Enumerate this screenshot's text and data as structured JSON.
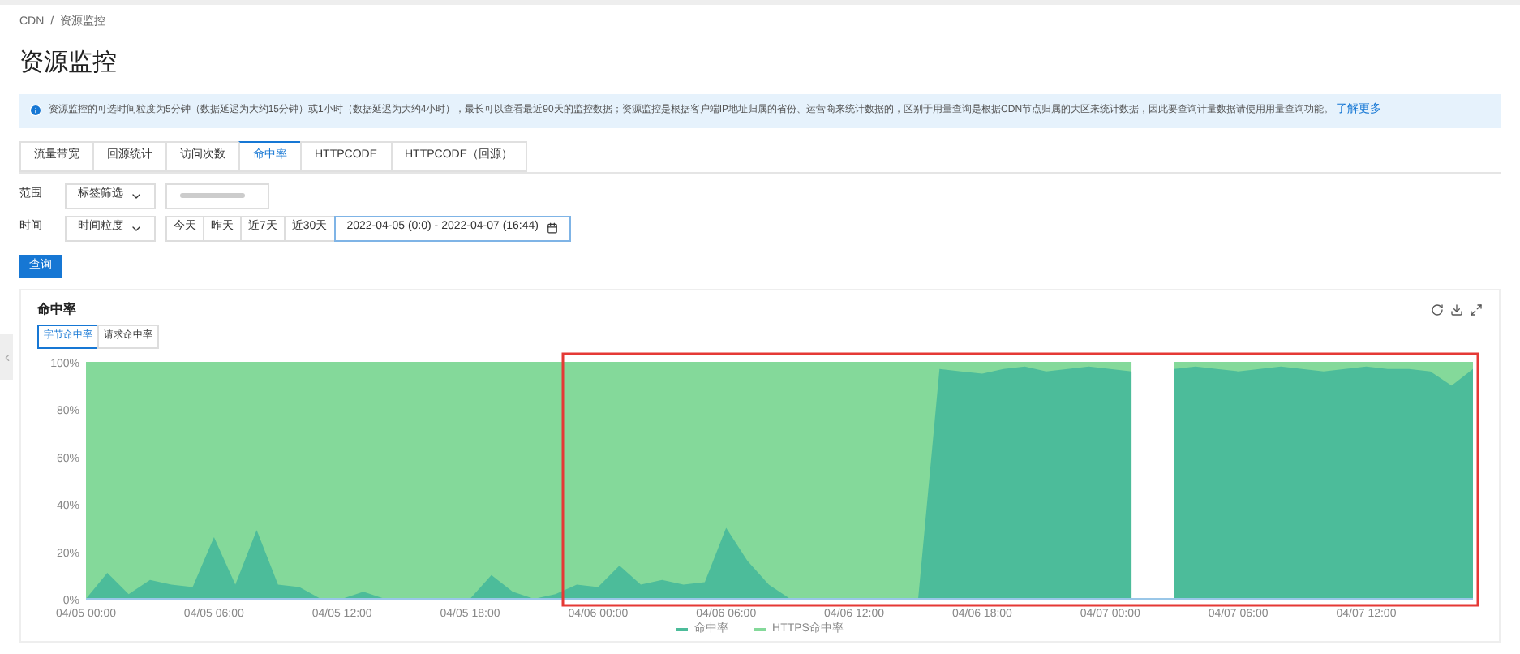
{
  "breadcrumb": {
    "separator": "/",
    "items": [
      {
        "label": "CDN"
      },
      {
        "label": "资源监控"
      }
    ]
  },
  "title": "资源监控",
  "notice": {
    "text": "资源监控的可选时间粒度为5分钟（数据延迟为大约15分钟）或1小时（数据延迟为大约4小时），最长可以查看最近90天的监控数据；资源监控是根据客户端IP地址归属的省份、运营商来统计数据的，区别于用量查询是根据CDN节点归属的大区来统计数据，因此要查询计量数据请使用用量查询功能。",
    "link": "了解更多"
  },
  "tabs": [
    {
      "label": "流量带宽",
      "selected": false
    },
    {
      "label": "回源统计",
      "selected": false
    },
    {
      "label": "访问次数",
      "selected": false
    },
    {
      "label": "命中率",
      "selected": true
    },
    {
      "label": "HTTPCODE",
      "selected": false
    },
    {
      "label": "HTTPCODE（回源）",
      "selected": false
    }
  ],
  "filters": {
    "scope_label": "范围",
    "scope_select": "标签筛选",
    "time_label": "时间",
    "time_select": "时间粒度",
    "quick_ranges": [
      "今天",
      "昨天",
      "近7天",
      "近30天"
    ],
    "date_range": "2022-04-05 (0:0) - 2022-04-07 (16:44)",
    "query_button": "查询"
  },
  "chart_card": {
    "title": "命中率",
    "toggles": [
      {
        "label": "字节命中率",
        "selected": true
      },
      {
        "label": "请求命中率",
        "selected": false
      }
    ],
    "chart_data": {
      "type": "area",
      "categories": [
        "04/05 00:00",
        null,
        null,
        null,
        null,
        null,
        "04/05 06:00",
        null,
        null,
        null,
        null,
        null,
        "04/05 12:00",
        null,
        null,
        null,
        null,
        null,
        "04/05 18:00",
        null,
        null,
        null,
        null,
        null,
        "04/06 00:00",
        null,
        null,
        null,
        null,
        null,
        "04/06 06:00",
        null,
        null,
        null,
        null,
        null,
        "04/06 12:00",
        null,
        null,
        null,
        null,
        null,
        "04/06 18:00",
        null,
        null,
        null,
        null,
        null,
        "04/07 00:00",
        null,
        null,
        null,
        null,
        null,
        "04/07 06:00",
        null,
        null,
        null,
        null,
        null,
        "04/07 12:00",
        null,
        null,
        null,
        null,
        null
      ],
      "yticks": [
        {
          "value": 0,
          "label": "0%"
        },
        {
          "value": 20,
          "label": "20%"
        },
        {
          "value": 40,
          "label": "40%"
        },
        {
          "value": 60,
          "label": "60%"
        },
        {
          "value": 80,
          "label": "80%"
        },
        {
          "value": 100,
          "label": "100%"
        }
      ],
      "ylim": [
        0,
        100
      ],
      "stacked": false,
      "legend": "bottom",
      "series": [
        {
          "name": "命中率",
          "color": "#4cbc9a",
          "values": [
            0,
            11,
            2,
            8,
            6,
            5,
            26,
            6,
            29,
            6,
            5,
            0,
            0,
            3,
            0,
            0,
            0,
            0,
            0,
            10,
            3,
            0,
            2,
            6,
            5,
            14,
            6,
            8,
            6,
            7,
            30,
            16,
            6,
            0,
            0,
            0,
            0,
            0,
            0,
            0,
            97,
            96,
            95,
            97,
            98,
            96,
            97,
            98,
            97,
            96,
            null,
            97,
            98,
            97,
            96,
            97,
            98,
            97,
            96,
            97,
            98,
            97,
            97,
            96,
            90,
            97
          ]
        },
        {
          "name": "HTTPS命中率",
          "color": "#84d99a",
          "values": [
            100,
            100,
            100,
            100,
            100,
            100,
            100,
            100,
            100,
            100,
            100,
            100,
            100,
            100,
            100,
            100,
            100,
            100,
            100,
            100,
            100,
            100,
            100,
            100,
            100,
            100,
            100,
            100,
            100,
            100,
            100,
            100,
            100,
            100,
            100,
            100,
            100,
            100,
            100,
            100,
            100,
            100,
            100,
            100,
            100,
            100,
            100,
            100,
            100,
            100,
            null,
            100,
            100,
            100,
            100,
            100,
            100,
            100,
            100,
            100,
            100,
            100,
            100,
            100,
            100,
            100
          ]
        }
      ]
    }
  }
}
